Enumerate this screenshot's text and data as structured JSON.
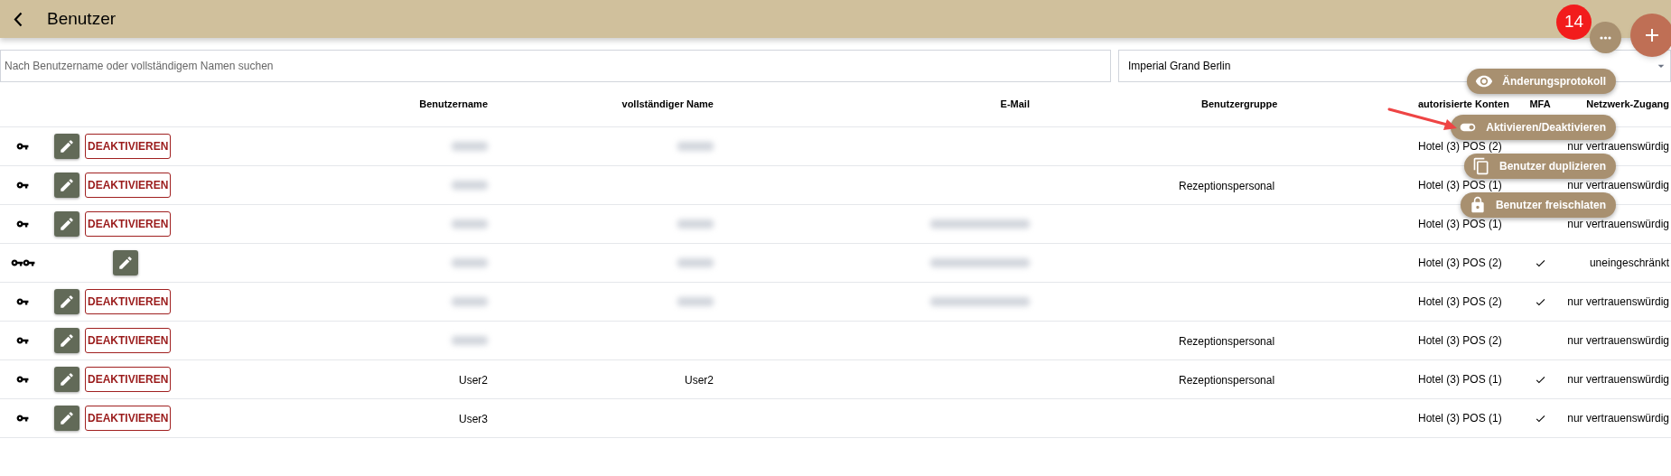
{
  "app_bar": {
    "title": "Benutzer"
  },
  "search": {
    "placeholder": "Nach Benutzername oder vollständigem Namen suchen"
  },
  "property_select": {
    "value": "Imperial Grand Berlin"
  },
  "fab": {
    "badge": "14"
  },
  "speed_dial": [
    {
      "kind": "eye",
      "label": "Änderungsprotokoll"
    },
    {
      "kind": "toggle",
      "label": "Aktivieren/Deaktivieren"
    },
    {
      "kind": "copy",
      "label": "Benutzer duplizieren"
    },
    {
      "kind": "lock",
      "label": "Benutzer freischlaten"
    }
  ],
  "table": {
    "columns": [
      "Benutzername",
      "vollständiger Name",
      "E-Mail",
      "Benutzergruppe",
      "autorisierte Konten",
      "MFA",
      "Netzwerk-Zugang"
    ],
    "rows": [
      {
        "double_key": false,
        "deactivate": "DEAKTIVIEREN",
        "redacted": {
          "username": true,
          "full_name": true
        },
        "accounts": "Hotel (3) POS (2)",
        "mfa": false,
        "network": "nur vertrauenswürdig"
      },
      {
        "double_key": false,
        "deactivate": "DEAKTIVIEREN",
        "redacted": {
          "username": true
        },
        "group": "Rezeptionspersonal",
        "accounts": "Hotel (3) POS (1)",
        "mfa": false,
        "network": "nur vertrauenswürdig"
      },
      {
        "double_key": false,
        "deactivate": "DEAKTIVIEREN",
        "redacted": {
          "username": true,
          "full_name": true,
          "email": true
        },
        "accounts": "Hotel (3) POS (1)",
        "mfa": false,
        "network": "nur vertrauenswürdig"
      },
      {
        "double_key": true,
        "redacted": {
          "username": true,
          "full_name": true,
          "email": true
        },
        "accounts": "Hotel (3) POS (2)",
        "mfa": true,
        "network": "uneingeschränkt"
      },
      {
        "double_key": false,
        "deactivate": "DEAKTIVIEREN",
        "redacted": {
          "username": true,
          "full_name": true,
          "email": true
        },
        "accounts": "Hotel (3) POS (2)",
        "mfa": true,
        "network": "nur vertrauenswürdig"
      },
      {
        "double_key": false,
        "deactivate": "DEAKTIVIEREN",
        "redacted": {
          "username": true
        },
        "group": "Rezeptionspersonal",
        "accounts": "Hotel (3) POS (2)",
        "mfa": false,
        "network": "nur vertrauenswürdig"
      },
      {
        "double_key": false,
        "deactivate": "DEAKTIVIEREN",
        "username": "User2",
        "full_name": "User2",
        "group": "Rezeptionspersonal",
        "accounts": "Hotel (3) POS (1)",
        "mfa": true,
        "network": "nur vertrauenswürdig"
      },
      {
        "double_key": false,
        "deactivate": "DEAKTIVIEREN",
        "username": "User3",
        "accounts": "Hotel (3) POS (1)",
        "mfa": true,
        "network": "nur vertrauenswürdig"
      }
    ]
  }
}
